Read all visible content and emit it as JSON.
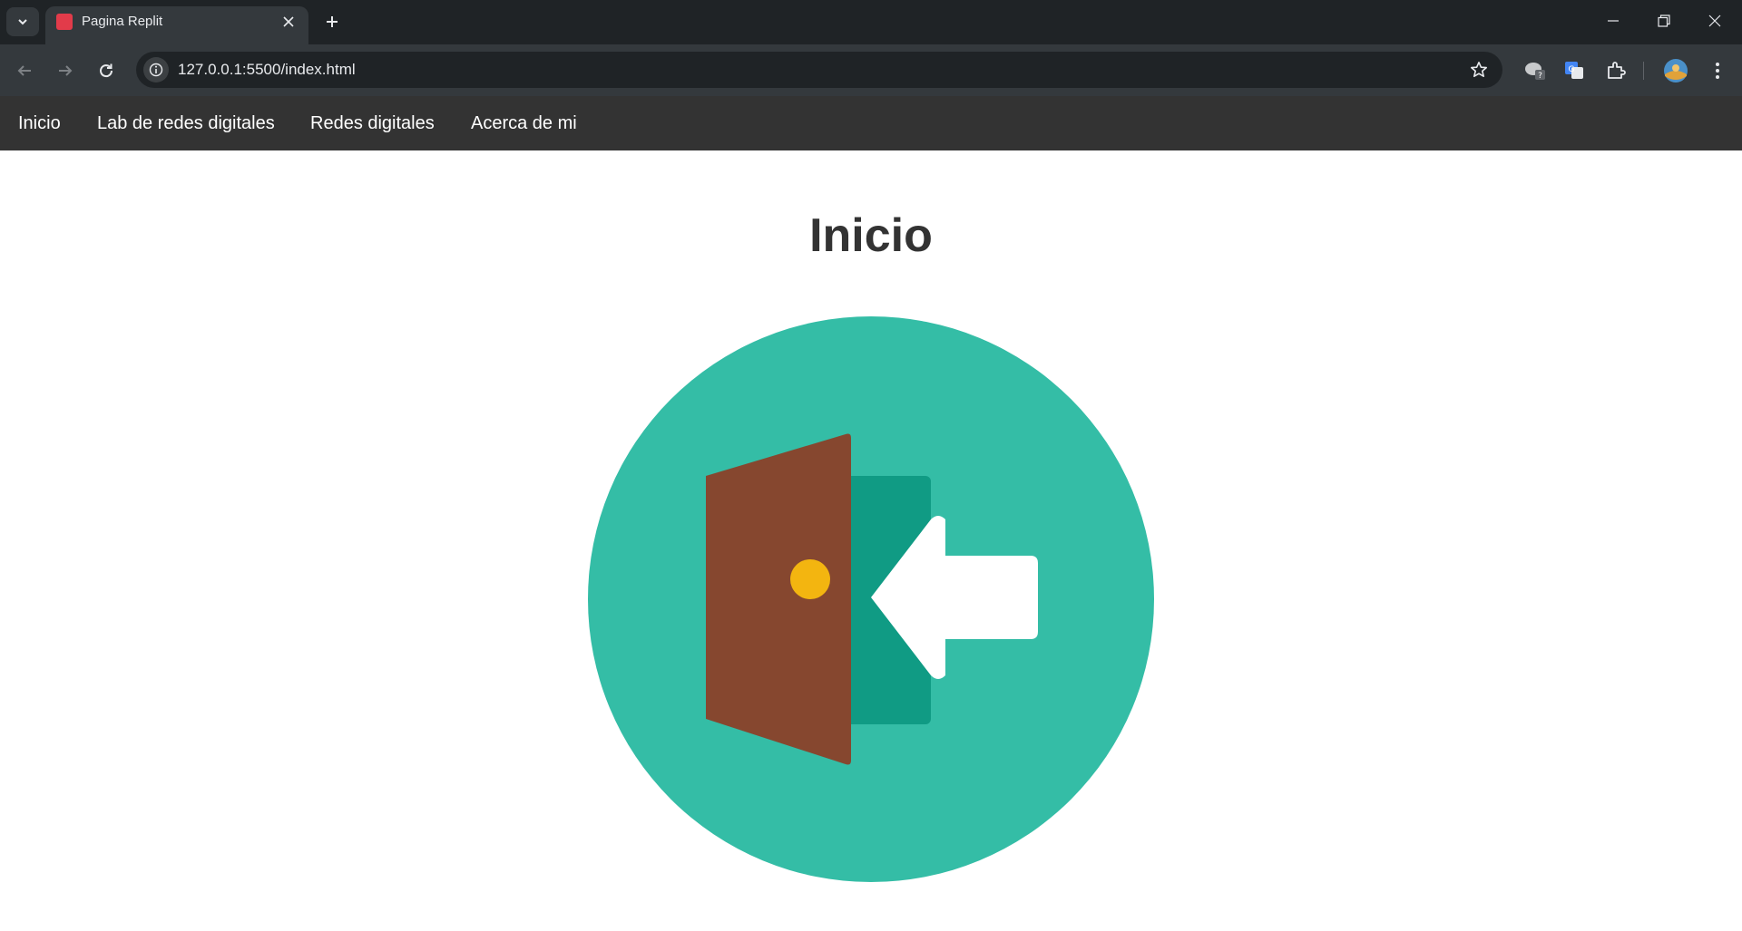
{
  "browser": {
    "tab_title": "Pagina Replit",
    "url": "127.0.0.1:5500/index.html"
  },
  "nav": {
    "items": [
      {
        "label": "Inicio"
      },
      {
        "label": "Lab de redes digitales"
      },
      {
        "label": "Redes digitales"
      },
      {
        "label": "Acerca de mi"
      }
    ]
  },
  "main": {
    "title": "Inicio",
    "image_icon": "door-enter-icon"
  },
  "colors": {
    "nav_bg": "#333333",
    "circle": "#34bda6",
    "door": "#86472f",
    "doorway": "#109b84",
    "knob": "#f3b510",
    "arrow": "#ffffff"
  }
}
